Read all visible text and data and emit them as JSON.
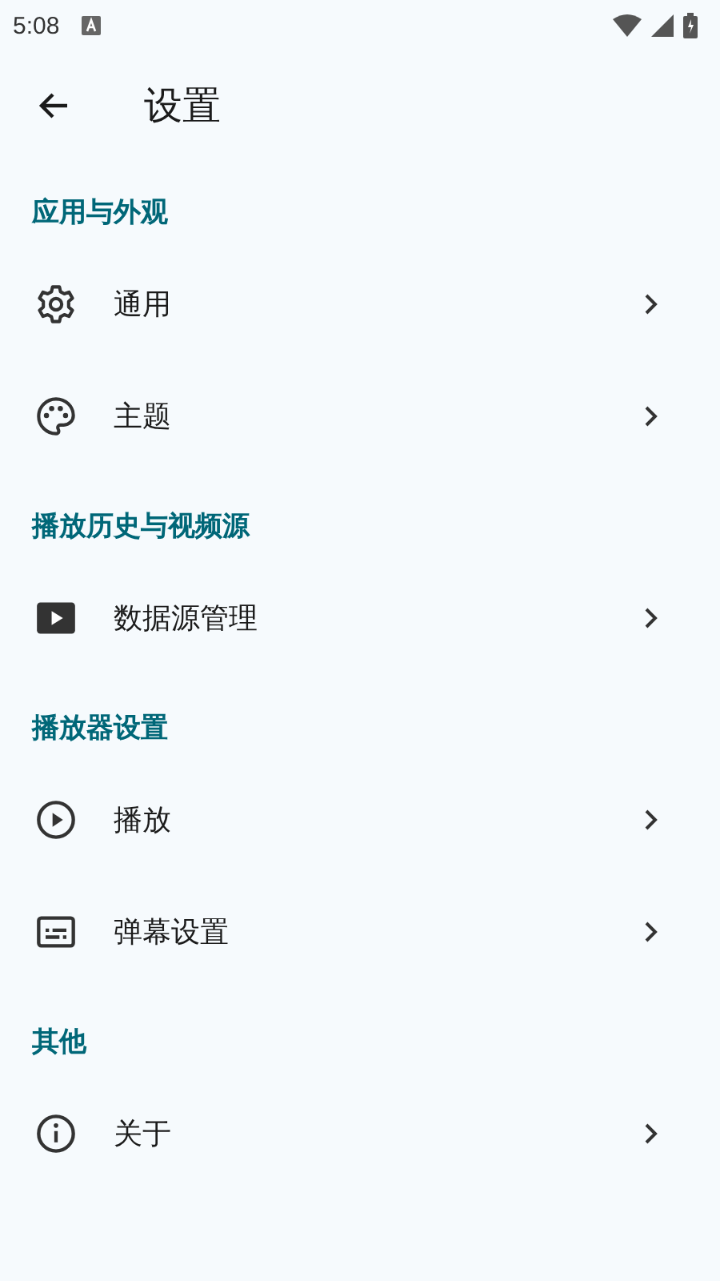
{
  "status_bar": {
    "time": "5:08"
  },
  "toolbar": {
    "title": "设置"
  },
  "sections": [
    {
      "title": "应用与外观",
      "items": [
        {
          "label": "通用",
          "kind": "gear"
        },
        {
          "label": "主题",
          "kind": "palette"
        }
      ]
    },
    {
      "title": "播放历史与视频源",
      "items": [
        {
          "label": "数据源管理",
          "kind": "video"
        }
      ]
    },
    {
      "title": "播放器设置",
      "items": [
        {
          "label": "播放",
          "kind": "play"
        },
        {
          "label": "弹幕设置",
          "kind": "subtitles"
        }
      ]
    },
    {
      "title": "其他",
      "items": [
        {
          "label": "关于",
          "kind": "info"
        }
      ]
    }
  ]
}
